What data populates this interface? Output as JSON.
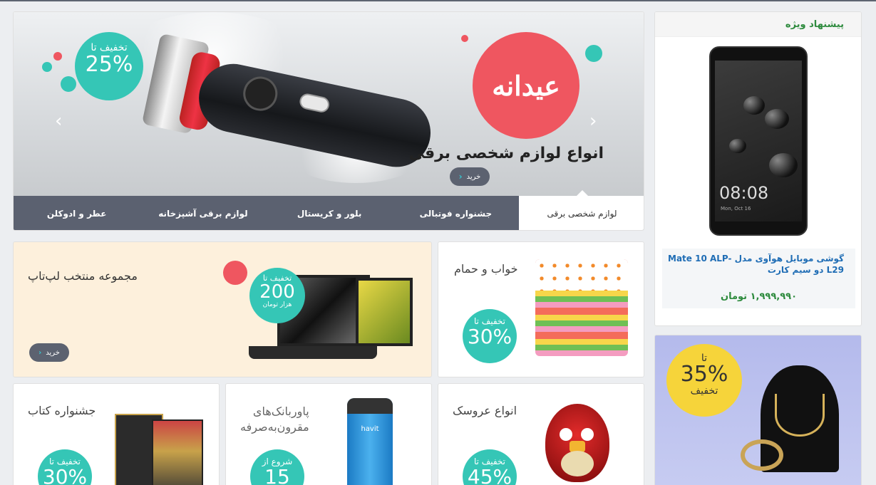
{
  "hero": {
    "discount_top": "تخفیف تا",
    "discount_value": "25%",
    "brand_logo": "عیدانه",
    "title": "انواع لوازم شخصی برقی",
    "buy_label": "خرید",
    "prev_label": "‹",
    "next_label": "›",
    "tabs": [
      "لوازم شخصی برقی",
      "جشنواره فوتبالی",
      "بلور و کریستال",
      "لوازم برقی آشپزخانه",
      "عطر و ادوکلن"
    ],
    "accent": "#ef5660",
    "teal": "#35c6b6"
  },
  "special_offer": {
    "heading": "پیشنهاد ویژه",
    "product_name": "گوشی موبایل هوآوی مدل Mate 10 ALP- L29 دو سیم کارت",
    "price": "۱,۹۹۹,۹۹۰ تومان",
    "phone_time": "08:08",
    "phone_date": "Mon, Oct 16"
  },
  "promos": {
    "laptop": {
      "title": "مجموعه منتخب لپ‌تاپ",
      "badge_top": "تخفیف تا",
      "badge_value": "200",
      "badge_unit": "هزار تومان",
      "buy_label": "خرید"
    },
    "bed": {
      "title": "خواب و حمام",
      "badge_top": "تخفیف تا",
      "badge_value": "30%"
    },
    "book": {
      "title": "جشنواره کتاب",
      "badge_top": "تخفیف تا",
      "badge_value": "30%"
    },
    "power": {
      "title_line1": "پاوربانک‌های",
      "title_line2": "مقرون‌به‌صرفه",
      "badge_top": "شروع از",
      "badge_value": "15",
      "product_label": "havit"
    },
    "doll": {
      "title": "انواع عروسک",
      "badge_top": "تخفیف تا",
      "badge_value": "45%"
    },
    "jewel": {
      "badge_top": "تا",
      "badge_value": "35%",
      "badge_bottom": "تخفیف"
    }
  }
}
